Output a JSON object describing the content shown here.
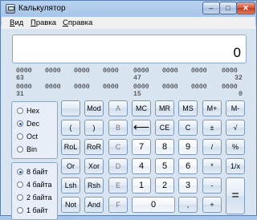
{
  "window": {
    "title": "Калькулятор",
    "close_label": "✕",
    "max_label": "□",
    "min_label": "–"
  },
  "menu": [
    {
      "key": "В",
      "rest": "ид"
    },
    {
      "key": "П",
      "rest": "равка"
    },
    {
      "key": "С",
      "rest": "правка"
    }
  ],
  "display": {
    "value": "0"
  },
  "bits": {
    "row1": [
      "0000",
      "0000",
      "0000",
      "0000",
      "0000",
      "0000",
      "0000",
      "0000"
    ],
    "row1_labels": [
      "63",
      "47",
      "32"
    ],
    "row2": [
      "0000",
      "0000",
      "0000",
      "0000",
      "0000",
      "0000",
      "0000",
      "0000"
    ],
    "row2_labels": [
      "31",
      "15",
      "0"
    ]
  },
  "base_options": [
    {
      "label": "Hex",
      "selected": false
    },
    {
      "label": "Dec",
      "selected": true
    },
    {
      "label": "Oct",
      "selected": false
    },
    {
      "label": "Bin",
      "selected": false
    }
  ],
  "word_options": [
    {
      "label": "8 байт",
      "selected": true
    },
    {
      "label": "4 байта",
      "selected": false
    },
    {
      "label": "2 байта",
      "selected": false
    },
    {
      "label": "1 байт",
      "selected": false
    }
  ],
  "keys": {
    "blank": "",
    "mod": "Mod",
    "a": "A",
    "mc": "MC",
    "mr": "MR",
    "ms": "MS",
    "mplus": "M+",
    "mminus": "M-",
    "lparen": "(",
    "rparen": ")",
    "b": "B",
    "back": "⟵",
    "ce": "CE",
    "c": "C",
    "plusminus": "±",
    "sqrt": "√",
    "rol": "RoL",
    "ror": "RoR",
    "c_hex": "C",
    "n7": "7",
    "n8": "8",
    "n9": "9",
    "div": "/",
    "pct": "%",
    "or": "Or",
    "xor": "Xor",
    "d": "D",
    "n4": "4",
    "n5": "5",
    "n6": "6",
    "mul": "*",
    "recip": "1/x",
    "lsh": "Lsh",
    "rsh": "Rsh",
    "e": "E",
    "n1": "1",
    "n2": "2",
    "n3": "3",
    "minus": "-",
    "eq": "=",
    "not": "Not",
    "and": "And",
    "f": "F",
    "n0": "0",
    "dot": ",",
    "plus": "+"
  }
}
